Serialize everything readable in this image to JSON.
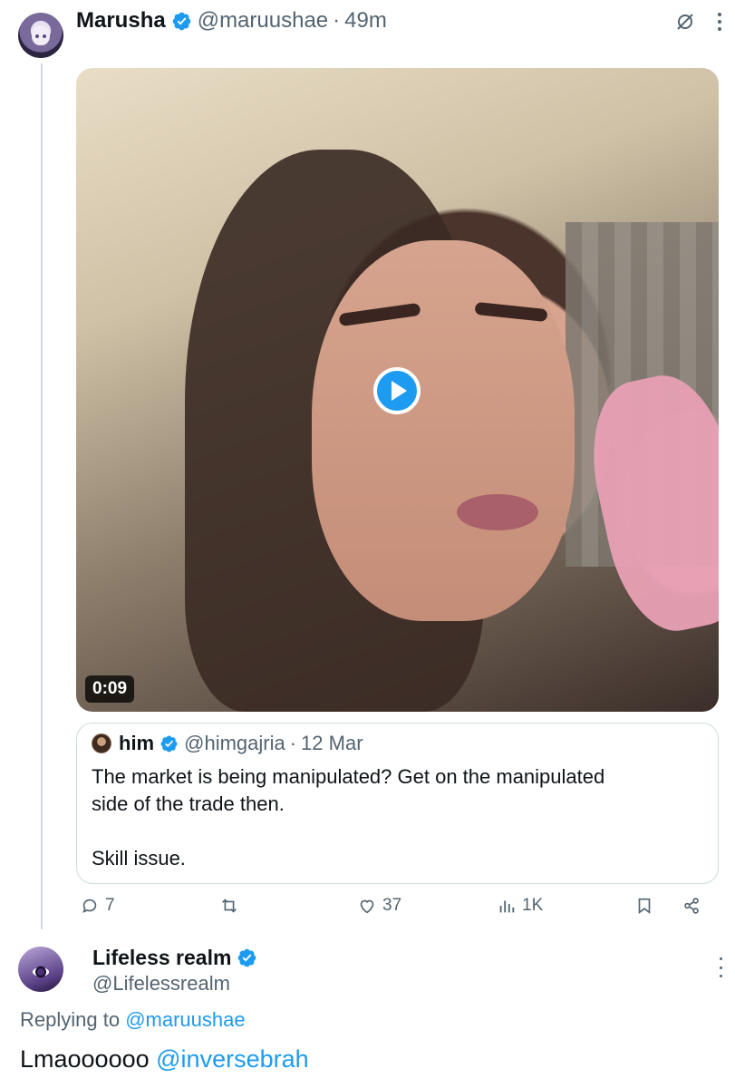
{
  "tweet": {
    "author_name": "Marusha",
    "author_handle": "@maruushae",
    "separator": "·",
    "time": "49m",
    "video_duration": "0:09",
    "quote": {
      "author_name": "him",
      "author_handle": "@himgajria",
      "separator": "·",
      "time": "12 Mar",
      "text": "The market is being manipulated? Get on the manipulated\nside of the trade then.\n\nSkill issue."
    },
    "actions": {
      "replies": "7",
      "reposts": "",
      "likes": "37",
      "views": "1K"
    }
  },
  "reply": {
    "author_name": "Lifeless realm",
    "author_handle": "@Lifelessrealm",
    "replying_label": "Replying to",
    "replying_handle": "@maruushae",
    "text": "Lmaoooooo",
    "mention": "@inversebrah"
  },
  "colors": {
    "accent": "#1d9bf0",
    "secondary_text": "#536471",
    "border": "#cfd9de"
  }
}
